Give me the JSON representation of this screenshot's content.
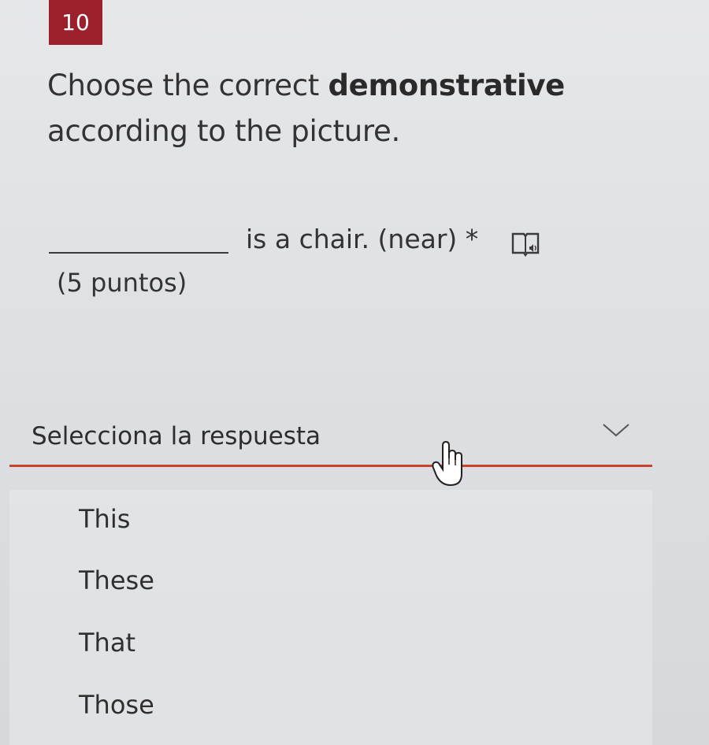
{
  "question": {
    "number": "10",
    "text_before": "Choose the correct ",
    "text_bold": "demonstrative",
    "text_after": " according to the picture.",
    "prompt": "is a chair. (near) *",
    "points": "(5 puntos)"
  },
  "icons": {
    "reader": "immersive-reader-icon",
    "chevron": "chevron-down-icon",
    "cursor": "hand-pointer-cursor-icon"
  },
  "dropdown": {
    "placeholder": "Selecciona la respuesta",
    "options": [
      "This",
      "These",
      "That",
      "Those"
    ]
  },
  "colors": {
    "badge": "#9c1f2c",
    "underline": "#c8442a"
  }
}
